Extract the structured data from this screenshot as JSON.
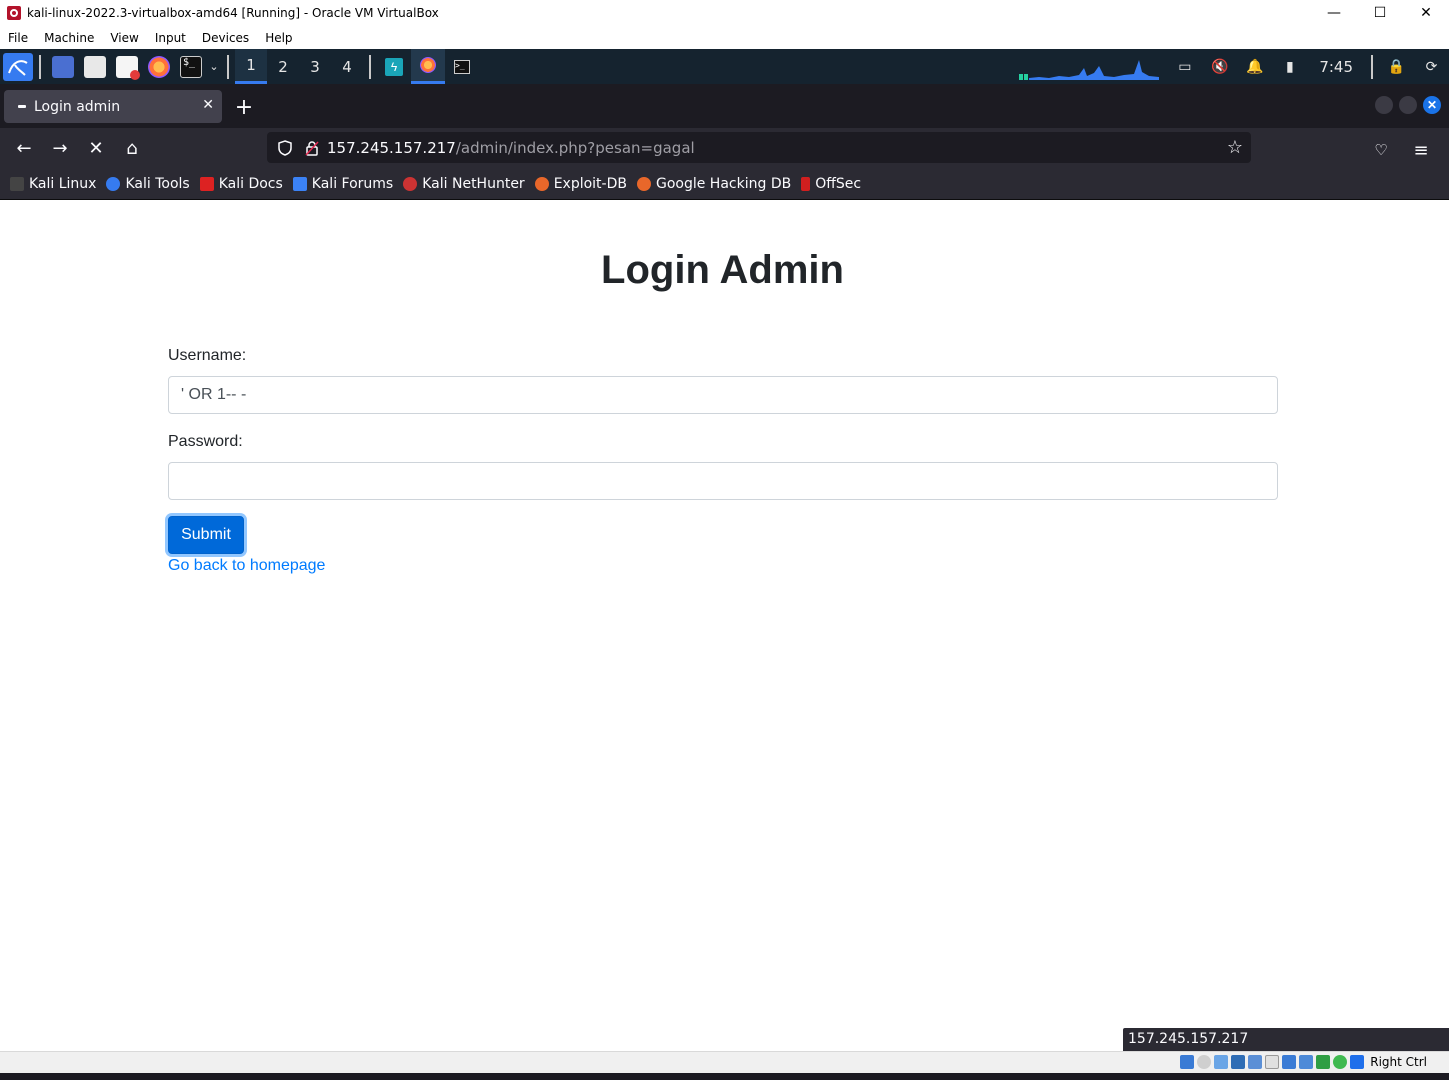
{
  "host_window": {
    "title": "kali-linux-2022.3-virtualbox-amd64 [Running] - Oracle VM VirtualBox",
    "menu": [
      "File",
      "Machine",
      "View",
      "Input",
      "Devices",
      "Help"
    ],
    "controls": {
      "minimize": "—",
      "maximize": "☐",
      "close": "✕"
    }
  },
  "panel": {
    "workspaces": [
      "1",
      "2",
      "3",
      "4"
    ],
    "active_workspace": "1",
    "clock": "7:45"
  },
  "browser": {
    "tab_title": "Login admin",
    "url_host": "157.245.157.217",
    "url_path": "/admin/index.php?pesan=gagal",
    "bookmarks": [
      "Kali Linux",
      "Kali Tools",
      "Kali Docs",
      "Kali Forums",
      "Kali NetHunter",
      "Exploit-DB",
      "Google Hacking DB",
      "OffSec"
    ],
    "status_url": "157.245.157.217"
  },
  "login_form": {
    "title": "Login Admin",
    "username_label": "Username:",
    "username_value": "' OR 1-- -",
    "password_label": "Password:",
    "password_value": "",
    "submit_label": "Submit",
    "home_link": "Go back to homepage"
  },
  "vb_status": {
    "host_key": "Right Ctrl"
  },
  "colors": {
    "primary_button": "#0069d9",
    "link": "#007bff",
    "panel_bg": "#15232f",
    "browser_bg": "#2b2a33"
  }
}
